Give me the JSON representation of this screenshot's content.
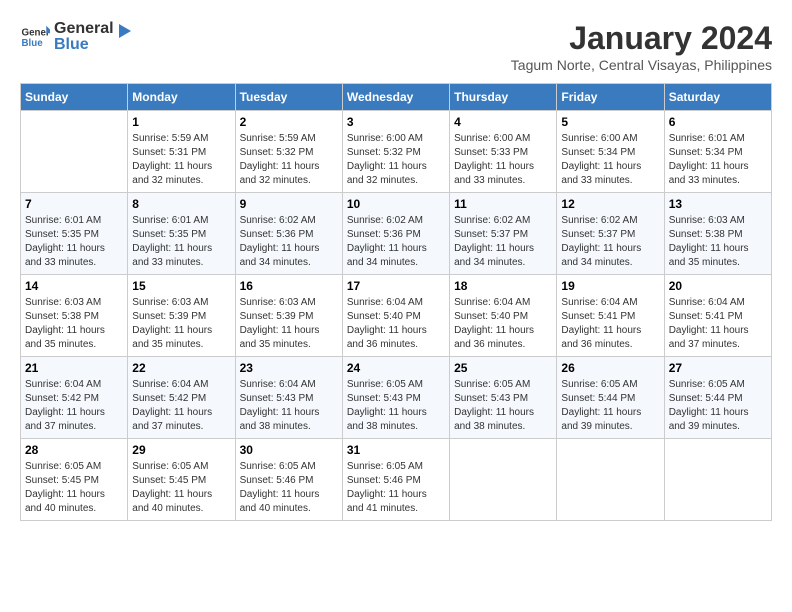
{
  "header": {
    "logo_general": "General",
    "logo_blue": "Blue",
    "month_title": "January 2024",
    "location": "Tagum Norte, Central Visayas, Philippines"
  },
  "days_of_week": [
    "Sunday",
    "Monday",
    "Tuesday",
    "Wednesday",
    "Thursday",
    "Friday",
    "Saturday"
  ],
  "weeks": [
    [
      {
        "day": "",
        "sunrise": "",
        "sunset": "",
        "daylight": ""
      },
      {
        "day": "1",
        "sunrise": "Sunrise: 5:59 AM",
        "sunset": "Sunset: 5:31 PM",
        "daylight": "Daylight: 11 hours and 32 minutes."
      },
      {
        "day": "2",
        "sunrise": "Sunrise: 5:59 AM",
        "sunset": "Sunset: 5:32 PM",
        "daylight": "Daylight: 11 hours and 32 minutes."
      },
      {
        "day": "3",
        "sunrise": "Sunrise: 6:00 AM",
        "sunset": "Sunset: 5:32 PM",
        "daylight": "Daylight: 11 hours and 32 minutes."
      },
      {
        "day": "4",
        "sunrise": "Sunrise: 6:00 AM",
        "sunset": "Sunset: 5:33 PM",
        "daylight": "Daylight: 11 hours and 33 minutes."
      },
      {
        "day": "5",
        "sunrise": "Sunrise: 6:00 AM",
        "sunset": "Sunset: 5:34 PM",
        "daylight": "Daylight: 11 hours and 33 minutes."
      },
      {
        "day": "6",
        "sunrise": "Sunrise: 6:01 AM",
        "sunset": "Sunset: 5:34 PM",
        "daylight": "Daylight: 11 hours and 33 minutes."
      }
    ],
    [
      {
        "day": "7",
        "sunrise": "Sunrise: 6:01 AM",
        "sunset": "Sunset: 5:35 PM",
        "daylight": "Daylight: 11 hours and 33 minutes."
      },
      {
        "day": "8",
        "sunrise": "Sunrise: 6:01 AM",
        "sunset": "Sunset: 5:35 PM",
        "daylight": "Daylight: 11 hours and 33 minutes."
      },
      {
        "day": "9",
        "sunrise": "Sunrise: 6:02 AM",
        "sunset": "Sunset: 5:36 PM",
        "daylight": "Daylight: 11 hours and 34 minutes."
      },
      {
        "day": "10",
        "sunrise": "Sunrise: 6:02 AM",
        "sunset": "Sunset: 5:36 PM",
        "daylight": "Daylight: 11 hours and 34 minutes."
      },
      {
        "day": "11",
        "sunrise": "Sunrise: 6:02 AM",
        "sunset": "Sunset: 5:37 PM",
        "daylight": "Daylight: 11 hours and 34 minutes."
      },
      {
        "day": "12",
        "sunrise": "Sunrise: 6:02 AM",
        "sunset": "Sunset: 5:37 PM",
        "daylight": "Daylight: 11 hours and 34 minutes."
      },
      {
        "day": "13",
        "sunrise": "Sunrise: 6:03 AM",
        "sunset": "Sunset: 5:38 PM",
        "daylight": "Daylight: 11 hours and 35 minutes."
      }
    ],
    [
      {
        "day": "14",
        "sunrise": "Sunrise: 6:03 AM",
        "sunset": "Sunset: 5:38 PM",
        "daylight": "Daylight: 11 hours and 35 minutes."
      },
      {
        "day": "15",
        "sunrise": "Sunrise: 6:03 AM",
        "sunset": "Sunset: 5:39 PM",
        "daylight": "Daylight: 11 hours and 35 minutes."
      },
      {
        "day": "16",
        "sunrise": "Sunrise: 6:03 AM",
        "sunset": "Sunset: 5:39 PM",
        "daylight": "Daylight: 11 hours and 35 minutes."
      },
      {
        "day": "17",
        "sunrise": "Sunrise: 6:04 AM",
        "sunset": "Sunset: 5:40 PM",
        "daylight": "Daylight: 11 hours and 36 minutes."
      },
      {
        "day": "18",
        "sunrise": "Sunrise: 6:04 AM",
        "sunset": "Sunset: 5:40 PM",
        "daylight": "Daylight: 11 hours and 36 minutes."
      },
      {
        "day": "19",
        "sunrise": "Sunrise: 6:04 AM",
        "sunset": "Sunset: 5:41 PM",
        "daylight": "Daylight: 11 hours and 36 minutes."
      },
      {
        "day": "20",
        "sunrise": "Sunrise: 6:04 AM",
        "sunset": "Sunset: 5:41 PM",
        "daylight": "Daylight: 11 hours and 37 minutes."
      }
    ],
    [
      {
        "day": "21",
        "sunrise": "Sunrise: 6:04 AM",
        "sunset": "Sunset: 5:42 PM",
        "daylight": "Daylight: 11 hours and 37 minutes."
      },
      {
        "day": "22",
        "sunrise": "Sunrise: 6:04 AM",
        "sunset": "Sunset: 5:42 PM",
        "daylight": "Daylight: 11 hours and 37 minutes."
      },
      {
        "day": "23",
        "sunrise": "Sunrise: 6:04 AM",
        "sunset": "Sunset: 5:43 PM",
        "daylight": "Daylight: 11 hours and 38 minutes."
      },
      {
        "day": "24",
        "sunrise": "Sunrise: 6:05 AM",
        "sunset": "Sunset: 5:43 PM",
        "daylight": "Daylight: 11 hours and 38 minutes."
      },
      {
        "day": "25",
        "sunrise": "Sunrise: 6:05 AM",
        "sunset": "Sunset: 5:43 PM",
        "daylight": "Daylight: 11 hours and 38 minutes."
      },
      {
        "day": "26",
        "sunrise": "Sunrise: 6:05 AM",
        "sunset": "Sunset: 5:44 PM",
        "daylight": "Daylight: 11 hours and 39 minutes."
      },
      {
        "day": "27",
        "sunrise": "Sunrise: 6:05 AM",
        "sunset": "Sunset: 5:44 PM",
        "daylight": "Daylight: 11 hours and 39 minutes."
      }
    ],
    [
      {
        "day": "28",
        "sunrise": "Sunrise: 6:05 AM",
        "sunset": "Sunset: 5:45 PM",
        "daylight": "Daylight: 11 hours and 40 minutes."
      },
      {
        "day": "29",
        "sunrise": "Sunrise: 6:05 AM",
        "sunset": "Sunset: 5:45 PM",
        "daylight": "Daylight: 11 hours and 40 minutes."
      },
      {
        "day": "30",
        "sunrise": "Sunrise: 6:05 AM",
        "sunset": "Sunset: 5:46 PM",
        "daylight": "Daylight: 11 hours and 40 minutes."
      },
      {
        "day": "31",
        "sunrise": "Sunrise: 6:05 AM",
        "sunset": "Sunset: 5:46 PM",
        "daylight": "Daylight: 11 hours and 41 minutes."
      },
      {
        "day": "",
        "sunrise": "",
        "sunset": "",
        "daylight": ""
      },
      {
        "day": "",
        "sunrise": "",
        "sunset": "",
        "daylight": ""
      },
      {
        "day": "",
        "sunrise": "",
        "sunset": "",
        "daylight": ""
      }
    ]
  ]
}
